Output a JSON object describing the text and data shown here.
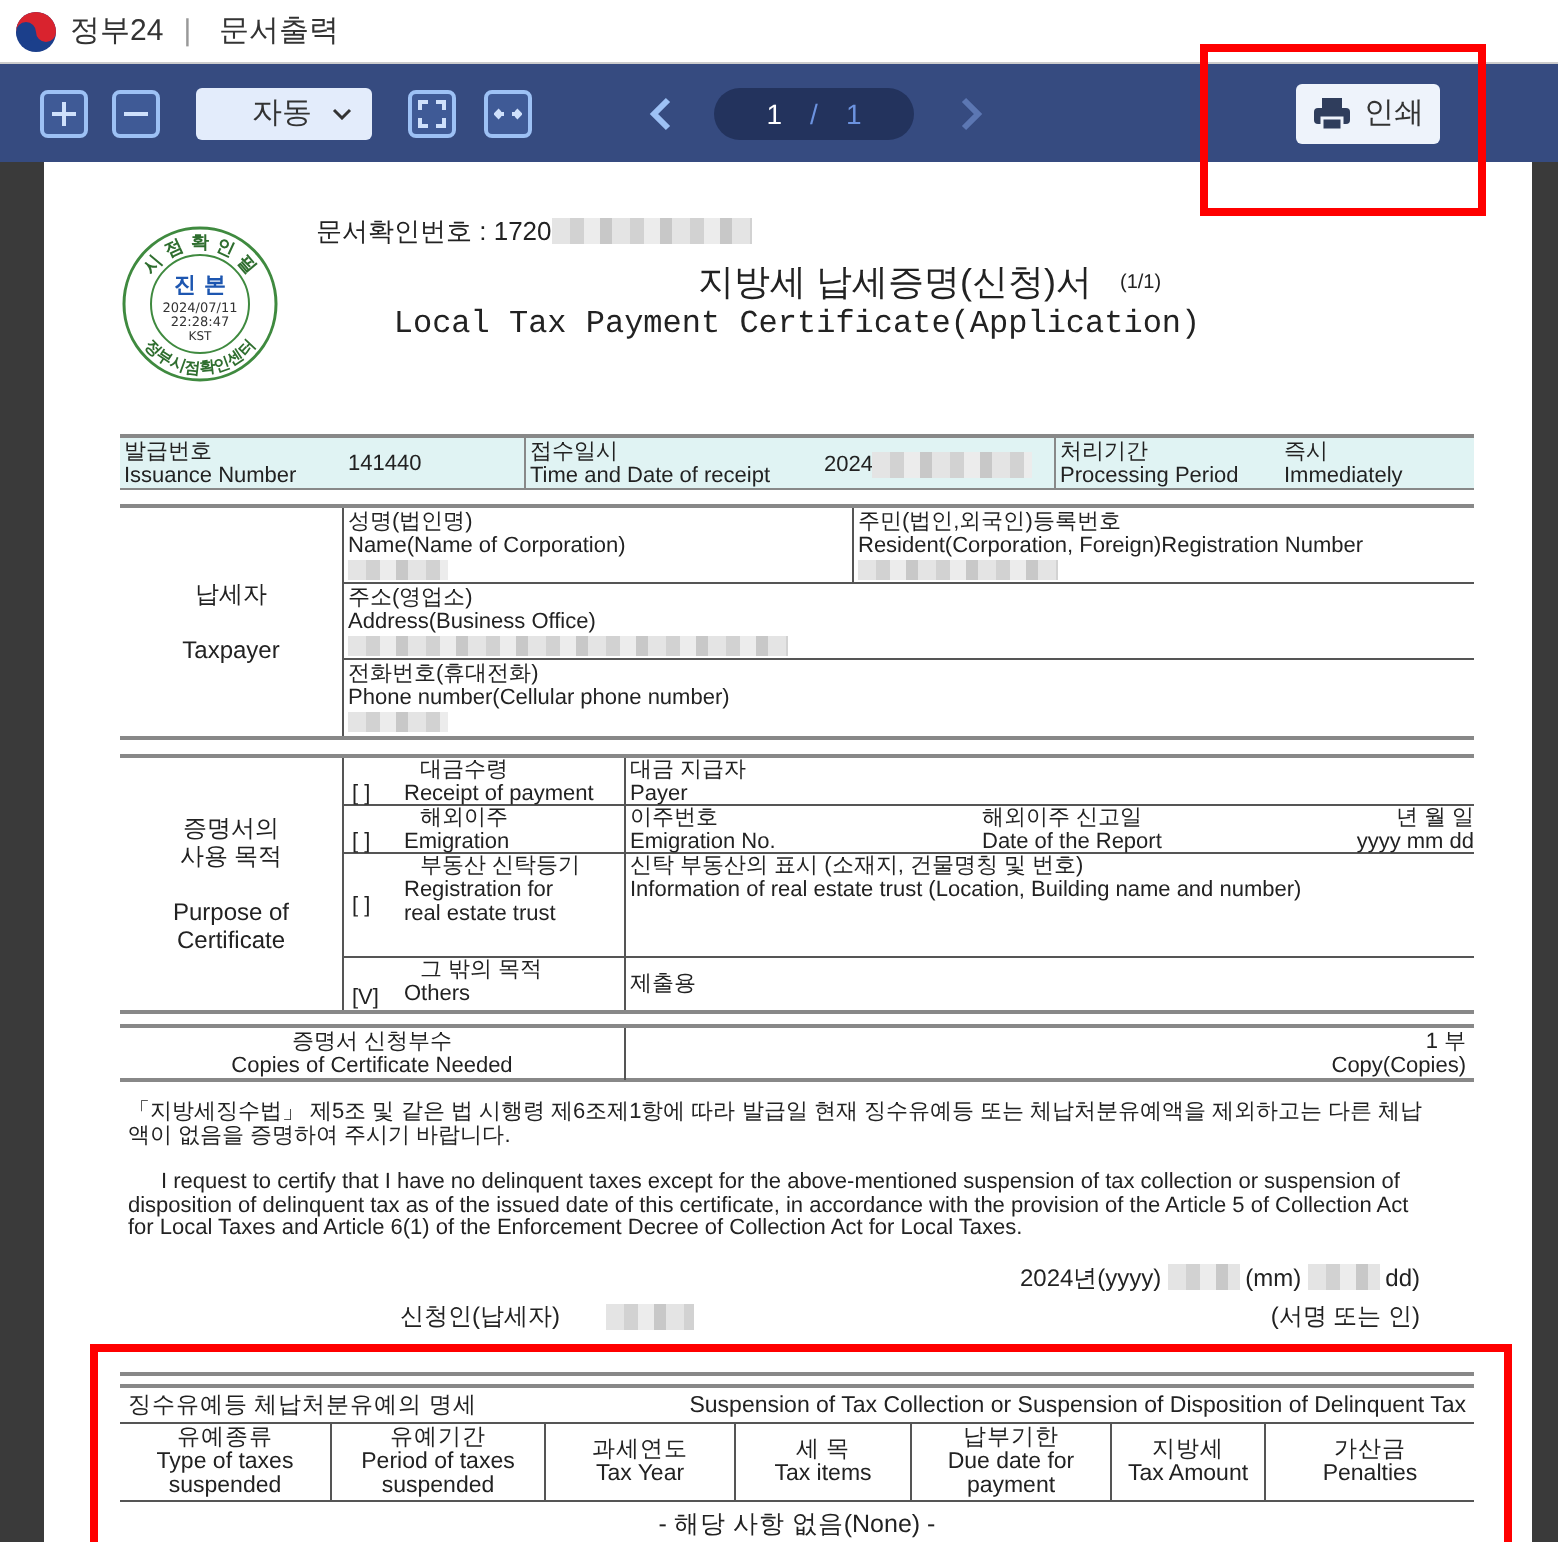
{
  "header": {
    "brand": "정부24",
    "divider": "|",
    "title": "문서출력"
  },
  "toolbar": {
    "zoom_mode": "자동",
    "page": {
      "current": "1",
      "separator": "/",
      "total": "1"
    },
    "print_button": {
      "label": "인쇄",
      "highlighted": true
    }
  },
  "document": {
    "verification": {
      "label": "문서확인번호 : 1720",
      "redacted": true
    },
    "seal": {
      "top": "시 점 확 인 필",
      "center": "진 본",
      "date": "2024/07/11",
      "time": "22:28:47",
      "zone": "KST",
      "bottom": "정부시점확인센터"
    },
    "title_ko": "지방세 납세증명(신청)서",
    "title_en": "Local Tax Payment Certificate(Application)",
    "page_count": "(1/1)",
    "issue_info": [
      {
        "label_ko": "발급번호",
        "label_en": "Issuance Number",
        "value": "141440"
      },
      {
        "label_ko": "접수일시",
        "label_en": "Time and Date of receipt",
        "value": "2024",
        "redacted": true
      },
      {
        "label_ko": "처리기간",
        "label_en": "Processing Period",
        "value": "즉시",
        "value_en": "Immediately"
      }
    ],
    "taxpayer": {
      "label_ko": "납세자",
      "label_en": "Taxpayer",
      "rows": [
        [
          {
            "label_ko": "성명(법인명)",
            "label_en": "Name(Name of Corporation)",
            "redacted": true
          },
          {
            "label_ko": "주민(법인,외국인)등록번호",
            "label_en": "Resident(Corporation, Foreign)Registration Number",
            "redacted": true
          }
        ],
        [
          {
            "label_ko": "주소(영업소)",
            "label_en": "Address(Business Office)",
            "redacted": true
          }
        ],
        [
          {
            "label_ko": "전화번호(휴대전화)",
            "label_en": "Phone number(Cellular phone number)",
            "redacted": true
          }
        ]
      ]
    },
    "purpose": {
      "label_ko": [
        "증명서의",
        "사용 목적"
      ],
      "label_en": [
        "Purpose of",
        "Certificate"
      ],
      "options": [
        {
          "box": "[ ]",
          "label_ko": "대금수령",
          "label_en": [
            "Receipt of payment"
          ],
          "details": [
            {
              "ko": "대금 지급자",
              "en": "Payer"
            }
          ]
        },
        {
          "box": "[ ]",
          "label_ko": "해외이주",
          "label_en": [
            "Emigration"
          ],
          "details": [
            {
              "ko": "이주번호",
              "en": "Emigration No."
            },
            {
              "ko": "해외이주 신고일",
              "en": "Date of the Report"
            },
            {
              "ko": "년 월 일",
              "en": "yyyy  mm  dd"
            }
          ]
        },
        {
          "box": "[ ]",
          "label_ko": "부동산 신탁등기",
          "label_en": [
            "Registration for",
            "real estate trust"
          ],
          "details": [
            {
              "ko": "신탁 부동산의 표시 (소재지, 건물명칭 및 번호)",
              "en": "Information of real estate trust (Location, Building name and number)"
            }
          ]
        },
        {
          "box": "[V]",
          "label_ko": "그 밖의 목적",
          "label_en": [
            "Others"
          ],
          "details": [
            {
              "ko": "제출용"
            }
          ]
        }
      ]
    },
    "copies": {
      "label_ko": "증명서 신청부수",
      "label_en": "Copies of Certificate Needed",
      "value_ko": "1 부",
      "value_en": "Copy(Copies)"
    },
    "statement_ko": "「지방세징수법」 제5조 및 같은 법 시행령 제6조제1항에 따라 발급일 현재 징수유예등 또는 체납처분유예액을 제외하고는 다른 체납액이 없음을 증명하여 주시기 바랍니다.",
    "statement_en": "I request to certify that I have no delinquent taxes except for the above-mentioned suspension of tax collection or suspension of disposition of delinquent tax as of the issued date of this certificate, in accordance with the provision of the Article 5 of Collection Act for Local Taxes and Article 6(1) of the Enforcement Decree of Collection Act for Local Taxes.",
    "date_line": [
      {
        "kind": "text",
        "text": "2024년(yyyy)"
      },
      {
        "kind": "redacted"
      },
      {
        "kind": "text",
        "text": "(mm)"
      },
      {
        "kind": "redacted"
      },
      {
        "kind": "text",
        "text": "dd)"
      }
    ],
    "applicant": {
      "label_ko": "신청인(납세자)",
      "redacted": true,
      "sign_ko": "(서명 또는 인)"
    },
    "suspension": {
      "highlighted": true,
      "title_ko": "징수유예등 체납처분유예의 명세",
      "title_en": "Suspension of Tax Collection or Suspension of Disposition of Delinquent Tax",
      "columns": [
        {
          "ko": "유예종류",
          "en": "Type of taxes suspended"
        },
        {
          "ko": "유예기간",
          "en": "Period of taxes suspended"
        },
        {
          "ko": "과세연도",
          "en": "Tax Year"
        },
        {
          "ko": "세 목",
          "en": "Tax items"
        },
        {
          "ko": "납부기한",
          "en": "Due date for payment"
        },
        {
          "ko": "지방세",
          "en": "Tax Amount"
        },
        {
          "ko": "가산금",
          "en": "Penalties"
        }
      ],
      "empty_text": "- 해당 사항 없음(None) -"
    }
  }
}
